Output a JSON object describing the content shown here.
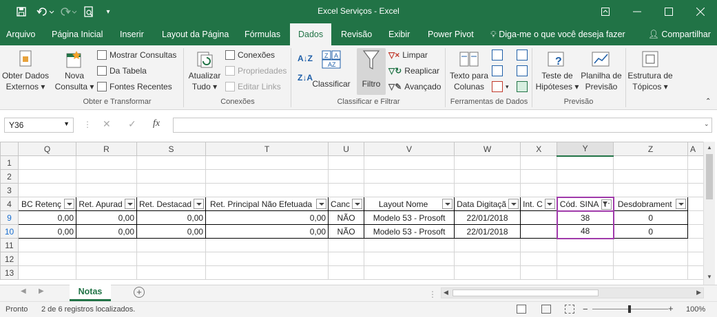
{
  "window": {
    "title": "Excel Serviços  -  Excel"
  },
  "tabs": [
    "Arquivo",
    "Página Inicial",
    "Inserir",
    "Layout da Página",
    "Fórmulas",
    "Dados",
    "Revisão",
    "Exibir",
    "Power Pivot"
  ],
  "tell_me": "Diga-me o que você deseja fazer",
  "share": "Compartilhar",
  "ribbon": {
    "obter_dados": [
      "Obter Dados",
      "Externos"
    ],
    "nova_consulta": [
      "Nova",
      "Consulta"
    ],
    "mostrar_consultas": "Mostrar Consultas",
    "da_tabela": "Da Tabela",
    "fontes_recentes": "Fontes Recentes",
    "group_obter": "Obter e Transformar",
    "atualizar": [
      "Atualizar",
      "Tudo"
    ],
    "conexoes": "Conexões",
    "propriedades": "Propriedades",
    "editar_links": "Editar Links",
    "group_conexoes": "Conexões",
    "classificar": "Classificar",
    "filtro": "Filtro",
    "limpar": "Limpar",
    "reaplicar": "Reaplicar",
    "avancado": "Avançado",
    "group_classificar": "Classificar e Filtrar",
    "texto_colunas": [
      "Texto para",
      "Colunas"
    ],
    "group_ferramentas": "Ferramentas de Dados",
    "teste_hipoteses": [
      "Teste de",
      "Hipóteses"
    ],
    "planilha_previsao": [
      "Planilha de",
      "Previsão"
    ],
    "group_previsao": "Previsão",
    "estrutura_topicos": [
      "Estrutura de",
      "Tópicos"
    ]
  },
  "namebox": "Y36",
  "columns": [
    "Q",
    "R",
    "S",
    "T",
    "U",
    "V",
    "W",
    "X",
    "Y",
    "Z",
    "A"
  ],
  "row_numbers": [
    "1",
    "2",
    "3",
    "4",
    "9",
    "10",
    "11",
    "12",
    "13"
  ],
  "headers": [
    "BC Retenç",
    "Ret. Apurad",
    "Ret. Destacad",
    "Ret. Principal Não Efetuada",
    "Canc",
    "Layout Nome",
    "Data Digitaçã",
    "Int. C",
    "Cód. SINA",
    "Desdobrament"
  ],
  "rows": [
    [
      "0,00",
      "0,00",
      "0,00",
      "0,00",
      "NÃO",
      "Modelo 53 - Prosoft",
      "22/01/2018",
      "",
      "38",
      "0"
    ],
    [
      "0,00",
      "0,00",
      "0,00",
      "0,00",
      "NÃO",
      "Modelo 53 - Prosoft",
      "22/01/2018",
      "",
      "48",
      "0"
    ]
  ],
  "sheet_tab": "Notas",
  "status": {
    "ready": "Pronto",
    "message": "2 de 6 registros localizados.",
    "zoom": "100%"
  },
  "colors": {
    "brand": "#217346",
    "selection": "#a03aaa"
  }
}
